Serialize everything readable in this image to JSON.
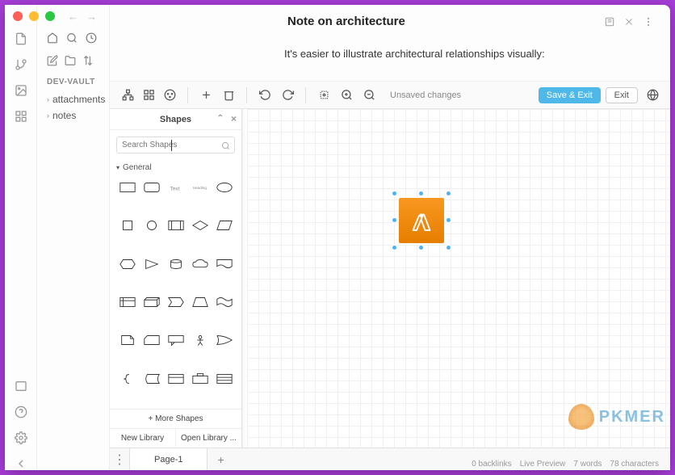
{
  "vault": {
    "name": "DEV-VAULT"
  },
  "tree": [
    {
      "label": "attachments"
    },
    {
      "label": "notes"
    }
  ],
  "note": {
    "title": "Note on architecture",
    "body": "It's easier to illustrate architectural relationships visually:"
  },
  "toolbar": {
    "status": "Unsaved changes",
    "save_exit": "Save & Exit",
    "exit": "Exit"
  },
  "shapes_panel": {
    "title": "Shapes",
    "search_placeholder": "Search Shapes",
    "section": "General",
    "more": "More Shapes",
    "new_library": "New Library",
    "open_library": "Open Library ..."
  },
  "pages": {
    "page1": "Page-1"
  },
  "watermark": "PKMER",
  "status": {
    "backlinks": "0 backlinks",
    "preview": "Live Preview",
    "words": "7 words",
    "chars": "78 characters"
  }
}
